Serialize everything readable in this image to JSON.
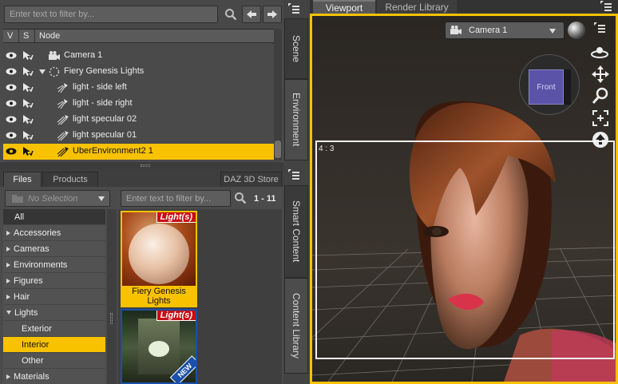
{
  "scene_pane": {
    "filter_placeholder": "Enter text to filter by...",
    "columns": [
      "V",
      "S",
      "Node"
    ],
    "nodes": [
      {
        "label": "Camera 1",
        "icon": "camera-icon",
        "indent": 0
      },
      {
        "label": "Fiery Genesis Lights",
        "icon": "group-icon",
        "indent": 0,
        "expanded": true
      },
      {
        "label": "light - side left",
        "icon": "spotlight-icon",
        "indent": 1
      },
      {
        "label": "light - side right",
        "icon": "spotlight-icon",
        "indent": 1
      },
      {
        "label": "light specular 02",
        "icon": "distant-light-icon",
        "indent": 1
      },
      {
        "label": "light specular 01",
        "icon": "distant-light-icon",
        "indent": 1
      },
      {
        "label": "UberEnvironment2 1",
        "icon": "distant-light-icon",
        "indent": 1,
        "selected": true
      }
    ]
  },
  "content_pane": {
    "tabs": [
      "Files",
      "Products"
    ],
    "store_label": "DAZ 3D Store",
    "selection_placeholder": "No Selection",
    "filter_placeholder": "Enter text to filter by...",
    "range": "1 - 11",
    "categories": [
      {
        "label": "All",
        "type": "all"
      },
      {
        "label": "Accessories",
        "type": "collapsed"
      },
      {
        "label": "Cameras",
        "type": "collapsed"
      },
      {
        "label": "Environments",
        "type": "collapsed"
      },
      {
        "label": "Figures",
        "type": "collapsed"
      },
      {
        "label": "Hair",
        "type": "collapsed"
      },
      {
        "label": "Lights",
        "type": "expanded"
      },
      {
        "label": "Exterior",
        "type": "child"
      },
      {
        "label": "Interior",
        "type": "child",
        "selected": true
      },
      {
        "label": "Other",
        "type": "child"
      },
      {
        "label": "Materials",
        "type": "collapsed"
      }
    ],
    "items": [
      {
        "title": "Fiery Genesis Lights",
        "badge": "Light(s)"
      },
      {
        "title": "",
        "badge": "Light(s)",
        "new_badge": "NEW"
      }
    ]
  },
  "side_tabs": [
    "Scene",
    "Environment",
    "Smart Content",
    "Content Library"
  ],
  "viewport": {
    "tabs": [
      "Viewport",
      "Render Library"
    ],
    "camera": "Camera 1",
    "cube_label": "Front",
    "aspect": "4 : 3"
  },
  "colors": {
    "accent": "#f8c200",
    "badge": "#c80d14",
    "new_badge": "#1b4fa8"
  }
}
